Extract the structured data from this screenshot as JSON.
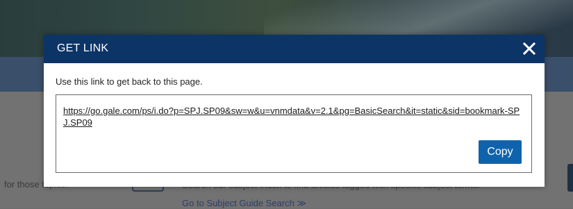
{
  "background": {
    "left_text": "for those topics.",
    "middle_text": "Search our subject index to find articles tagged with specific subject terms.",
    "link_text": "Go to Subject Guide Search ≫"
  },
  "modal": {
    "title": "GET LINK",
    "close_icon": "close-icon",
    "instruction": "Use this link to get back to this page.",
    "url": "https://go.gale.com/ps/i.do?p=SPJ.SP09&sw=w&u=vnmdata&v=2.1&pg=BasicSearch&it=static&sid=bookmark-SPJ.SP09",
    "copy_label": "Copy"
  },
  "colors": {
    "header_bg": "#0c3466",
    "copy_button_bg": "#0f63ad",
    "overlay": "#6e6e6e"
  }
}
